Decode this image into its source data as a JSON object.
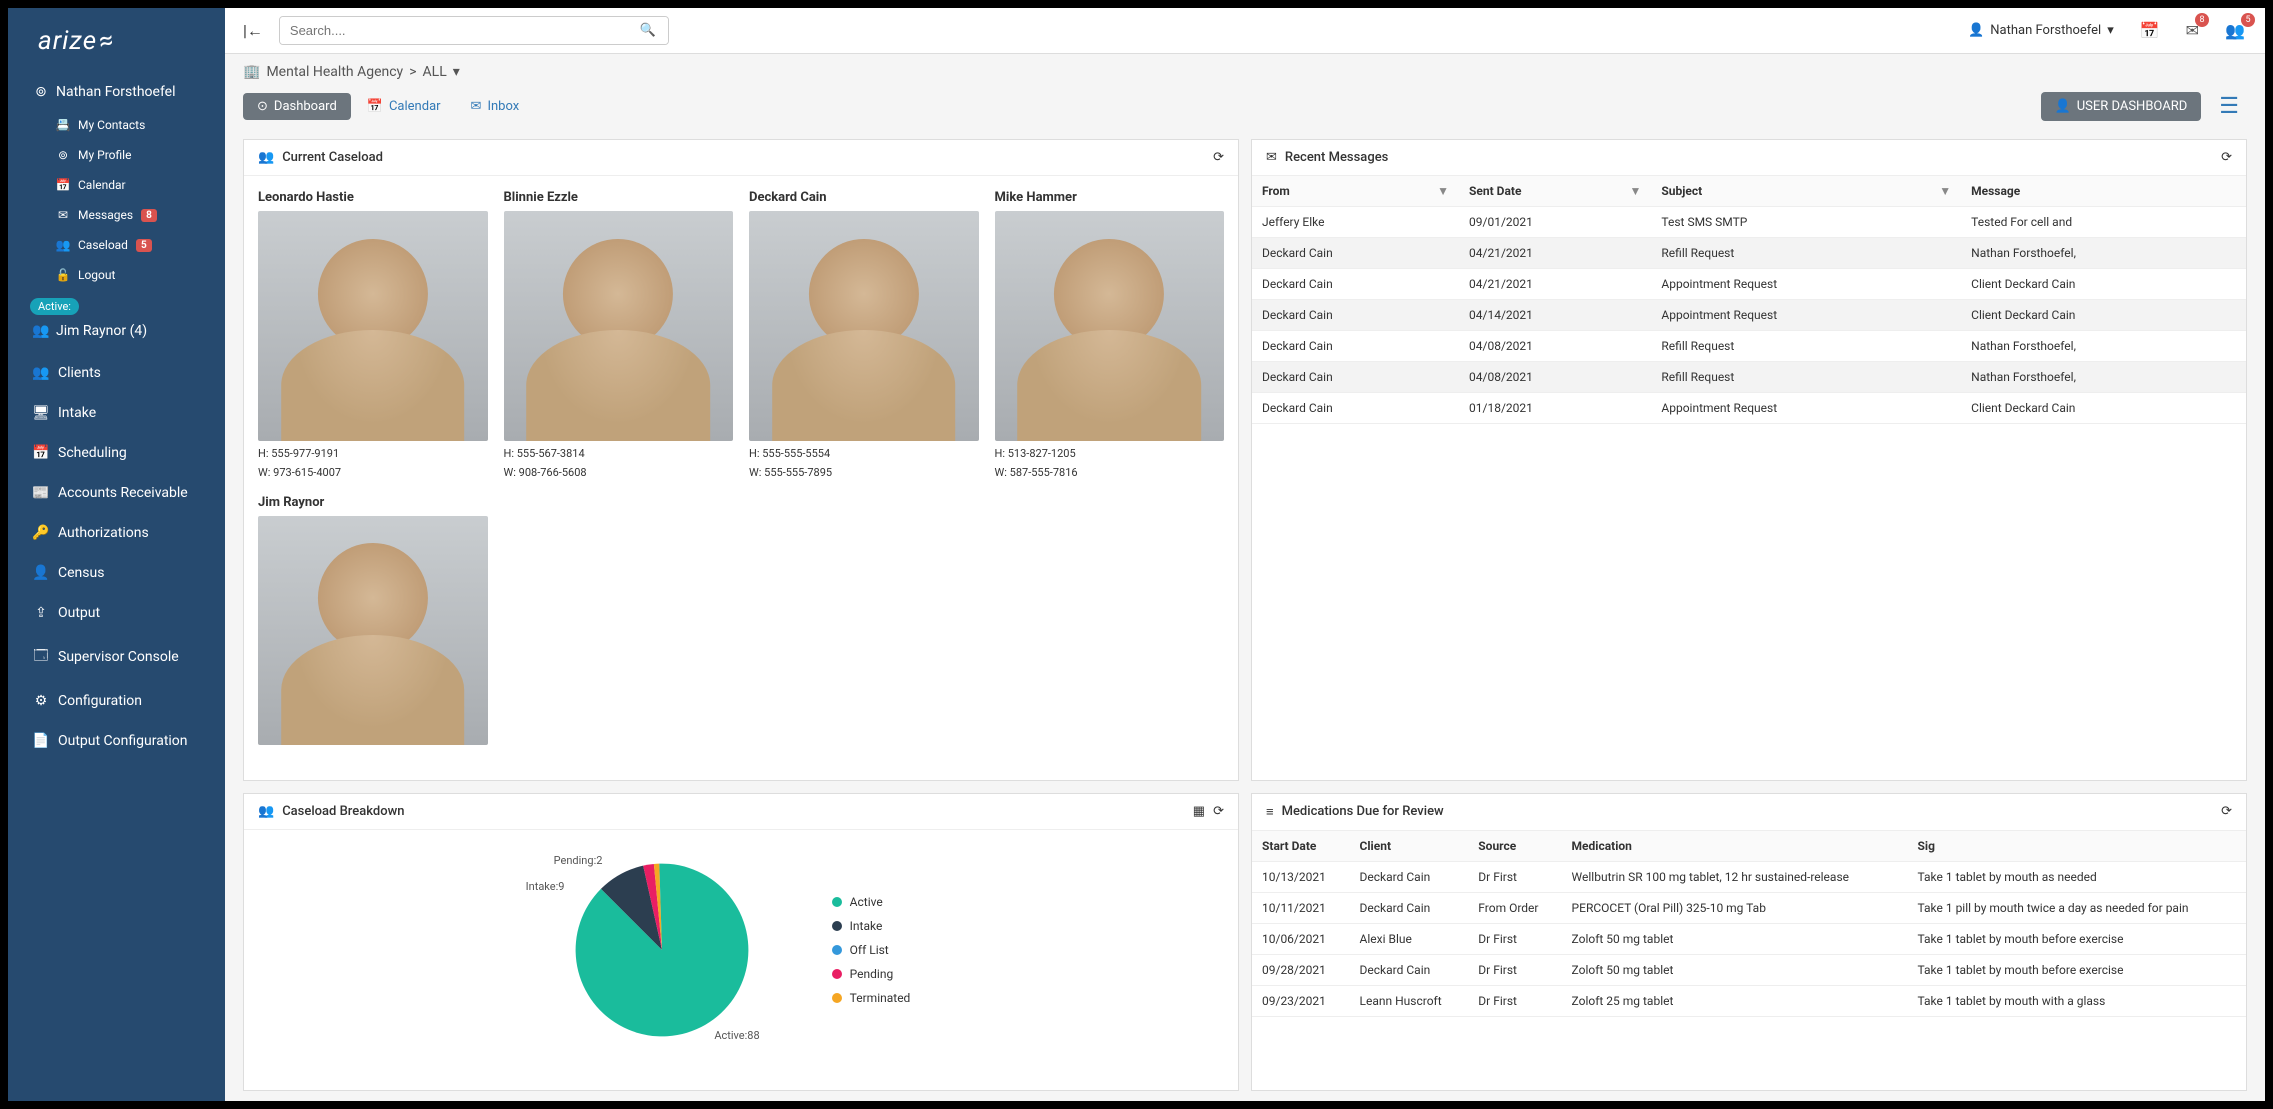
{
  "brand": "arize",
  "search": {
    "placeholder": "Search...."
  },
  "top_user": "Nathan Forsthoefel",
  "top_notifications": {
    "mail": "8",
    "group": "5"
  },
  "sidebar": {
    "user": "Nathan Forsthoefel",
    "items": [
      {
        "label": "My Contacts",
        "icon": "📇"
      },
      {
        "label": "My Profile",
        "icon": "⊚"
      },
      {
        "label": "Calendar",
        "icon": "📅"
      },
      {
        "label": "Messages",
        "icon": "✉",
        "badge": "8"
      },
      {
        "label": "Caseload",
        "icon": "👥",
        "badge": "5"
      },
      {
        "label": "Logout",
        "icon": "🔓"
      }
    ],
    "active_label": "Active:",
    "active_user": "Jim Raynor (4)",
    "nav": [
      {
        "label": "Clients",
        "icon": "👥"
      },
      {
        "label": "Intake",
        "icon": "🖥"
      },
      {
        "label": "Scheduling",
        "icon": "📅"
      },
      {
        "label": "Accounts Receivable",
        "icon": "📰"
      },
      {
        "label": "Authorizations",
        "icon": "🔑"
      },
      {
        "label": "Census",
        "icon": "👤"
      },
      {
        "label": "Output",
        "icon": "⇪"
      },
      {
        "label": "Supervisor Console",
        "icon": "🗔"
      },
      {
        "label": "Configuration",
        "icon": "⚙"
      },
      {
        "label": "Output Configuration",
        "icon": "📄"
      }
    ]
  },
  "breadcrumb": {
    "agency": "Mental Health Agency",
    "scope": "ALL"
  },
  "tabs": {
    "dashboard": "Dashboard",
    "calendar": "Calendar",
    "inbox": "Inbox",
    "user_dashboard": "USER DASHBOARD"
  },
  "panels": {
    "caseload": "Current Caseload",
    "messages": "Recent Messages",
    "breakdown": "Caseload Breakdown",
    "medications": "Medications Due for Review"
  },
  "caseload": [
    {
      "name": "Leonardo Hastie",
      "home": "H: 555-977-9191",
      "work": "W: 973-615-4007"
    },
    {
      "name": "Blinnie Ezzle",
      "home": "H: 555-567-3814",
      "work": "W: 908-766-5608"
    },
    {
      "name": "Deckard Cain",
      "home": "H: 555-555-5554",
      "work": "W: 555-555-7895"
    },
    {
      "name": "Mike Hammer",
      "home": "H: 513-827-1205",
      "work": "W: 587-555-7816"
    },
    {
      "name": "Jim Raynor",
      "home": "",
      "work": ""
    }
  ],
  "messages": {
    "headers": {
      "from": "From",
      "sent": "Sent Date",
      "subject": "Subject",
      "message": "Message"
    },
    "rows": [
      {
        "from": "Jeffery Elke",
        "sent": "09/01/2021",
        "subject": "Test SMS SMTP",
        "message": "Tested For cell and"
      },
      {
        "from": "Deckard Cain",
        "sent": "04/21/2021",
        "subject": "Refill Request",
        "message": "Nathan Forsthoefel,"
      },
      {
        "from": "Deckard Cain",
        "sent": "04/21/2021",
        "subject": "Appointment Request",
        "message": "Client Deckard Cain"
      },
      {
        "from": "Deckard Cain",
        "sent": "04/14/2021",
        "subject": "Appointment Request",
        "message": "Client Deckard Cain"
      },
      {
        "from": "Deckard Cain",
        "sent": "04/08/2021",
        "subject": "Refill Request",
        "message": "Nathan Forsthoefel,"
      },
      {
        "from": "Deckard Cain",
        "sent": "04/08/2021",
        "subject": "Refill Request",
        "message": "Nathan Forsthoefel,"
      },
      {
        "from": "Deckard Cain",
        "sent": "01/18/2021",
        "subject": "Appointment Request",
        "message": "Client Deckard Cain"
      }
    ]
  },
  "chart_data": {
    "type": "pie",
    "title": "Caseload Breakdown",
    "series": [
      {
        "name": "Active",
        "value": 88,
        "color": "#1abc9c"
      },
      {
        "name": "Intake",
        "value": 9,
        "color": "#2c3e50"
      },
      {
        "name": "Off List",
        "value": 0,
        "color": "#3498db"
      },
      {
        "name": "Pending",
        "value": 2,
        "color": "#e91e63"
      },
      {
        "name": "Terminated",
        "value": 1,
        "color": "#f5a623"
      }
    ],
    "labels": {
      "active": "Active:88",
      "intake": "Intake:9",
      "pending": "Pending:2"
    }
  },
  "medications": {
    "headers": {
      "start": "Start Date",
      "client": "Client",
      "source": "Source",
      "medication": "Medication",
      "sig": "Sig"
    },
    "rows": [
      {
        "start": "10/13/2021",
        "client": "Deckard Cain",
        "source": "Dr First",
        "medication": "Wellbutrin SR 100 mg tablet, 12 hr sustained-release",
        "sig": "Take 1 tablet by mouth as needed"
      },
      {
        "start": "10/11/2021",
        "client": "Deckard Cain",
        "source": "From Order",
        "medication": "PERCOCET (Oral Pill) 325-10 mg Tab",
        "sig": "Take 1 pill by mouth twice a day as needed for pain"
      },
      {
        "start": "10/06/2021",
        "client": "Alexi Blue",
        "source": "Dr First",
        "medication": "Zoloft 50 mg tablet",
        "sig": "Take 1 tablet by mouth before exercise"
      },
      {
        "start": "09/28/2021",
        "client": "Deckard Cain",
        "source": "Dr First",
        "medication": "Zoloft 50 mg tablet",
        "sig": "Take 1 tablet by mouth before exercise"
      },
      {
        "start": "09/23/2021",
        "client": "Leann Huscroft",
        "source": "Dr First",
        "medication": "Zoloft 25 mg tablet",
        "sig": "Take 1 tablet by mouth with a glass"
      }
    ]
  }
}
